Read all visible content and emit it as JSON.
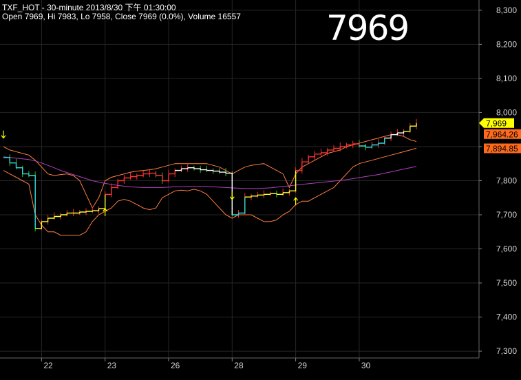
{
  "header": {
    "title": "TXF_HOT - 30-minute 2013/8/30 下午 01:30:00",
    "ohlc": "Open 7969, Hi 7983, Lo 7958, Close 7969 (0.0%), Volume 16557",
    "big_price": "7969"
  },
  "price_labels": [
    {
      "text": "7,969",
      "value": 7969,
      "bg": "#ffff00",
      "fg": "#000000"
    },
    {
      "text": "7,964.26",
      "value": 7964.26,
      "bg": "#ff6a1a",
      "fg": "#000000"
    },
    {
      "text": "7,894.85",
      "value": 7894.85,
      "bg": "#ff6a1a",
      "fg": "#000000"
    }
  ],
  "colors": {
    "background": "#000000",
    "grid": "#262626",
    "axis_text": "#d8d8d8",
    "candles_up": "#ff2a2a",
    "candles_down": "#22cc22",
    "step_white": "#ffffff",
    "step_cyan": "#33dddd",
    "step_yellow": "#ffff33",
    "step_red": "#ff3333",
    "band": "#ff7f3f",
    "ma": "#b040c0",
    "arrow": "#ffff00"
  },
  "chart_data": {
    "type": "line",
    "title": "TXF_HOT - 30-minute 2013/8/30 下午 01:30:00",
    "ylim": [
      7280,
      8330
    ],
    "y_ticks": [
      {
        "value": 8300,
        "label": "8,300"
      },
      {
        "value": 8200,
        "label": "8,200"
      },
      {
        "value": 8100,
        "label": "8,100"
      },
      {
        "value": 8000,
        "label": "8,000"
      },
      {
        "value": 7900,
        "label": "7,900"
      },
      {
        "value": 7800,
        "label": "7,800"
      },
      {
        "value": 7700,
        "label": "7,700"
      },
      {
        "value": 7600,
        "label": "7,600"
      },
      {
        "value": 7500,
        "label": "7,500"
      },
      {
        "value": 7400,
        "label": "7,400"
      },
      {
        "value": 7300,
        "label": "7,300"
      }
    ],
    "x_count": 66,
    "x_ticks": [
      {
        "index": 6,
        "label": "22"
      },
      {
        "index": 16,
        "label": "23"
      },
      {
        "index": 26,
        "label": "26"
      },
      {
        "index": 36,
        "label": "28"
      },
      {
        "index": 46,
        "label": "29"
      },
      {
        "index": 56,
        "label": "30"
      }
    ],
    "grid": true,
    "price": [
      7868,
      7852,
      7838,
      7820,
      7815,
      7660,
      7680,
      7690,
      7695,
      7700,
      7705,
      7705,
      7708,
      7710,
      7712,
      7718,
      7760,
      7780,
      7800,
      7808,
      7812,
      7815,
      7820,
      7822,
      7815,
      7800,
      7820,
      7830,
      7835,
      7838,
      7835,
      7832,
      7830,
      7828,
      7825,
      7822,
      7700,
      7705,
      7752,
      7755,
      7758,
      7760,
      7762,
      7760,
      7765,
      7770,
      7830,
      7855,
      7870,
      7878,
      7882,
      7890,
      7895,
      7900,
      7905,
      7908,
      7902,
      7898,
      7905,
      7910,
      7925,
      7935,
      7940,
      7945,
      7960,
      7969
    ],
    "series": [
      {
        "values": [
          7900,
          7890,
          7885,
          7880,
          7875,
          7860,
          7840,
          7820,
          7815,
          7818,
          7820,
          7815,
          7800,
          7760,
          7720,
          7750,
          7800,
          7810,
          7815,
          7820,
          7825,
          7828,
          7830,
          7832,
          7835,
          7840,
          7845,
          7850,
          7850,
          7850,
          7850,
          7850,
          7850,
          7845,
          7840,
          7830,
          7820,
          7830,
          7840,
          7845,
          7848,
          7850,
          7840,
          7830,
          7820,
          7780,
          7820,
          7840,
          7850,
          7860,
          7870,
          7880,
          7885,
          7890,
          7900,
          7905,
          7910,
          7915,
          7920,
          7925,
          7930,
          7935,
          7935,
          7930,
          7920,
          7915
        ]
      },
      {
        "values": [
          7830,
          7820,
          7810,
          7800,
          7790,
          7700,
          7670,
          7650,
          7650,
          7640,
          7640,
          7640,
          7640,
          7650,
          7680,
          7700,
          7710,
          7720,
          7740,
          7745,
          7740,
          7730,
          7720,
          7715,
          7720,
          7750,
          7760,
          7770,
          7772,
          7770,
          7775,
          7770,
          7760,
          7740,
          7720,
          7700,
          7690,
          7700,
          7700,
          7700,
          7690,
          7680,
          7680,
          7685,
          7700,
          7710,
          7730,
          7740,
          7740,
          7750,
          7760,
          7770,
          7780,
          7800,
          7820,
          7840,
          7850,
          7855,
          7860,
          7865,
          7870,
          7875,
          7880,
          7885,
          7890,
          7895
        ]
      },
      {
        "values": [
          7870,
          7868,
          7866,
          7864,
          7862,
          7858,
          7852,
          7845,
          7838,
          7830,
          7824,
          7818,
          7812,
          7806,
          7800,
          7796,
          7792,
          7789,
          7786,
          7784,
          7782,
          7781,
          7780,
          7780,
          7780,
          7780,
          7781,
          7782,
          7782,
          7783,
          7783,
          7783,
          7783,
          7782,
          7781,
          7780,
          7779,
          7778,
          7777,
          7777,
          7777,
          7778,
          7779,
          7781,
          7783,
          7785,
          7787,
          7789,
          7791,
          7793,
          7795,
          7797,
          7799,
          7801,
          7803,
          7806,
          7809,
          7812,
          7815,
          7818,
          7822,
          7826,
          7830,
          7834,
          7838,
          7842
        ]
      }
    ]
  }
}
